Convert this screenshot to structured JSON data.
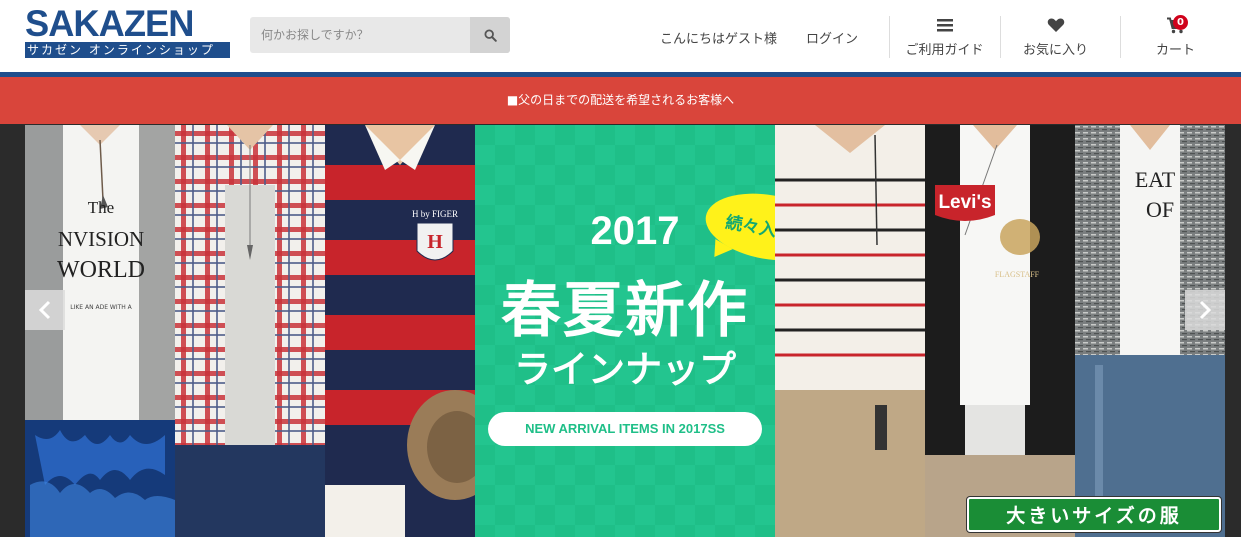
{
  "header": {
    "logo_main": "SAKAZEN",
    "logo_sub": "サカゼン オンラインショップ",
    "search_placeholder": "何かお探しですか？",
    "greeting": "こんにちはゲスト様",
    "login": "ログイン",
    "nav": {
      "guide": "ご利用ガイド",
      "favorites": "お気に入り",
      "cart": "カート",
      "cart_count": "0"
    }
  },
  "notice": {
    "text": "■父の日までの配送を希望されるお客様へ"
  },
  "hero": {
    "year": "2017",
    "bubble": "続々入荷中",
    "headline": "春夏新作",
    "subline": "ラインナップ",
    "pill": "NEW ARRIVAL ITEMS IN 2017SS",
    "size_badge": "大きいサイズの服",
    "tee_text_1": "The\nINVISION\nWORLD",
    "tee_brand_3": "H by FIGER",
    "tee_brand_6": "Levi's",
    "tee_brand_6b": "FLAGSTAFF",
    "tee_text_8": "EAT\nOF"
  },
  "colors": {
    "brand_blue": "#1f4e8c",
    "notice_red": "#d9453b",
    "hero_green": "#1fbf88",
    "bubble_yellow": "#fff21a",
    "badge_green": "#1a8d36",
    "cart_badge_red": "#d0021b"
  },
  "icons": {
    "search": "search-icon",
    "guide": "hamburger-menu-icon",
    "favorites": "heart-icon",
    "cart": "shopping-cart-icon",
    "prev": "chevron-left-icon",
    "next": "chevron-right-icon"
  }
}
